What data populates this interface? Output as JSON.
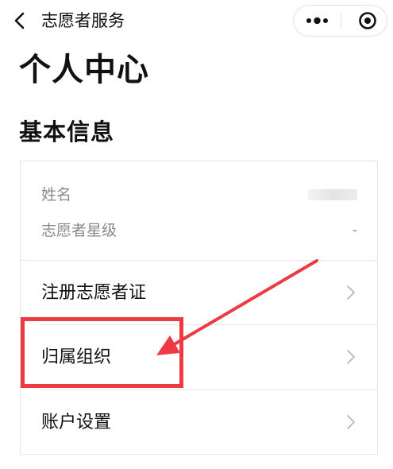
{
  "nav": {
    "title": "志愿者服务",
    "back_icon": "chevron-left-icon",
    "more_icon": "more-dots-icon",
    "close_icon": "target-close-icon"
  },
  "page_title": "个人中心",
  "section_title": "基本信息",
  "info": {
    "name_label": "姓名",
    "star_label": "志愿者星级",
    "star_value": "-"
  },
  "menu": [
    {
      "label": "注册志愿者证",
      "icon": "chevron-right-icon"
    },
    {
      "label": "归属组织",
      "icon": "chevron-right-icon"
    },
    {
      "label": "账户设置",
      "icon": "chevron-right-icon"
    }
  ],
  "colors": {
    "annotation": "#ee3a43",
    "muted_text": "#8a8a8a",
    "border": "#e6e6e6"
  }
}
